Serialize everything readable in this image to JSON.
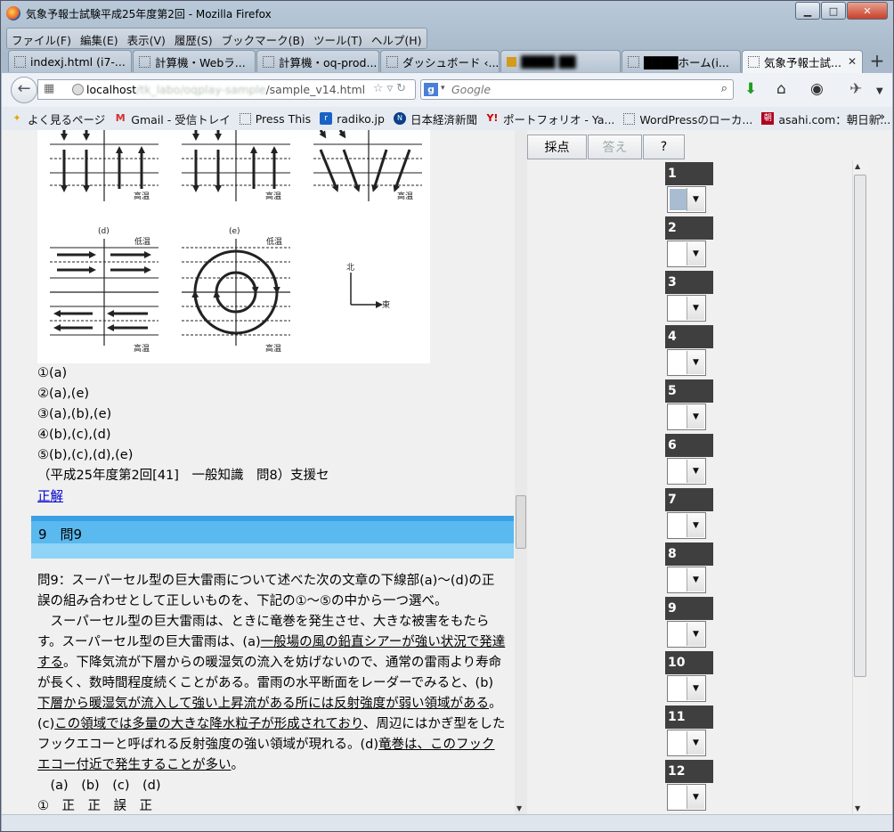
{
  "window": {
    "title": "気象予報士試験平成25年度第2回 - Mozilla Firefox",
    "minimize": "▁",
    "maximize": "□",
    "close": "✕"
  },
  "menubar": [
    "ファイル(F)",
    "編集(E)",
    "表示(V)",
    "履歴(S)",
    "ブックマーク(B)",
    "ツール(T)",
    "ヘルプ(H)"
  ],
  "tabs": [
    {
      "label": "indexj.html (i7-..."
    },
    {
      "label": "計算機・Webラ..."
    },
    {
      "label": "計算機・oq-prod..."
    },
    {
      "label": "ダッシュボード ‹..."
    },
    {
      "label": "████ ██"
    },
    {
      "label": "████ホーム(i..."
    },
    {
      "label": "気象予報士試..."
    }
  ],
  "navbar": {
    "url_host": "localhost",
    "url_blur": "/tk_labo/oqplay-sample",
    "url_path": "/sample_v14.html",
    "search_placeholder": "Google"
  },
  "bookmarks": [
    {
      "label": "よく見るページ",
      "icon": "star-icon"
    },
    {
      "label": "Gmail - 受信トレイ",
      "icon": "gmail-icon"
    },
    {
      "label": "Press This",
      "icon": "page-icon"
    },
    {
      "label": "radiko.jp",
      "icon": "radiko-icon"
    },
    {
      "label": "日本経済新聞",
      "icon": "nikkei-icon"
    },
    {
      "label": "ポートフォリオ - Ya...",
      "icon": "yahoo-icon"
    },
    {
      "label": "WordPressのローカ...",
      "icon": "page-icon"
    },
    {
      "label": "asahi.com：朝日新...",
      "icon": "asahi-icon"
    }
  ],
  "figure": {
    "label_d": "(d)",
    "label_e": "(e)",
    "hot": "高温",
    "cold": "低温",
    "north": "北",
    "east": "東"
  },
  "choices": [
    "①(a)",
    "②(a),(e)",
    "③(a),(b),(e)",
    "④(b),(c),(d)",
    "⑤(b),(c),(d),(e)"
  ],
  "source_note": "（平成25年度第2回[41]　一般知識　問8）支援セ",
  "correct_link": "正解",
  "question9": {
    "header": "9　問9",
    "intro": "問9：スーパーセル型の巨大雷雨について述べた次の文章の下線部(a)～(d)の正誤の組み合わせとして正しいものを、下記の①～⑤の中から一つ選べ。",
    "p1": "　スーパーセル型の巨大雷雨は、ときに竜巻を発生させ、大きな被害をもたらす。スーパーセル型の巨大雷雨は、",
    "a_mark": "(a)",
    "a_text": "一般場の風の鉛直シアーが強い状況で発達する",
    "p2": "。下降気流が下層からの暖湿気の流入を妨げないので、通常の雷雨より寿命が長く、数時間程度続くことがある。雷雨の水平断面をレーダーでみると、",
    "b_mark": "(b)",
    "b_text": "下層から暖湿気が流入して強い上昇流がある所には反射強度が弱い領域がある",
    "p3": "。",
    "c_mark": "(c)",
    "c_text": "この領域では多量の大きな降水粒子が形成されており",
    "p4": "、周辺にはかぎ型をしたフックエコーと呼ばれる反射強度の強い領域が現れる。",
    "d_mark": "(d)",
    "d_text": "竜巻は、このフックエコー付近で発生することが多い",
    "p5": "。",
    "table_header": "　(a)　(b)　(c)　(d)",
    "row1": "①　正　正　誤　正"
  },
  "right_panel": {
    "grade_button": "採点",
    "answer_button": "答え",
    "help_button": "?",
    "questions": [
      "1",
      "2",
      "3",
      "4",
      "5",
      "6",
      "7",
      "8",
      "9",
      "10",
      "11",
      "12"
    ]
  }
}
